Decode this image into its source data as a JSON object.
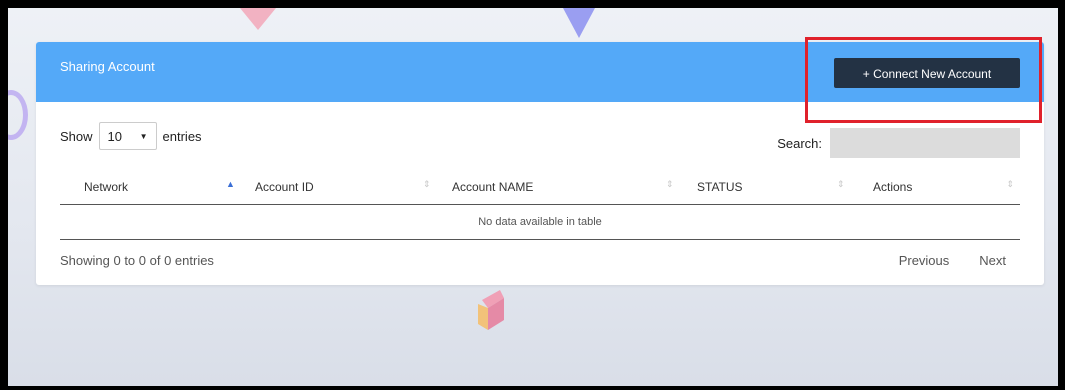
{
  "card": {
    "title": "Sharing Account",
    "connect_label": "+ Connect New Account"
  },
  "controls": {
    "show_label": "Show",
    "page_length": "10",
    "entries_label": "entries",
    "search_label": "Search:"
  },
  "table": {
    "columns": [
      {
        "label": "Network",
        "sort": "asc",
        "sort_icon": "sort-up-icon"
      },
      {
        "label": "Account ID",
        "sort": "none",
        "sort_icon": "sort-both-icon"
      },
      {
        "label": "Account NAME",
        "sort": "none",
        "sort_icon": "sort-both-icon"
      },
      {
        "label": "STATUS",
        "sort": "none",
        "sort_icon": "sort-both-icon"
      },
      {
        "label": "Actions",
        "sort": "none",
        "sort_icon": "sort-both-icon"
      }
    ],
    "empty_message": "No data available in table"
  },
  "footer": {
    "info": "Showing 0 to 0 of 0 entries",
    "previous": "Previous",
    "next": "Next"
  },
  "colors": {
    "header_bg": "#54a9f8",
    "button_bg": "#233244",
    "highlight": "#e0212b"
  }
}
